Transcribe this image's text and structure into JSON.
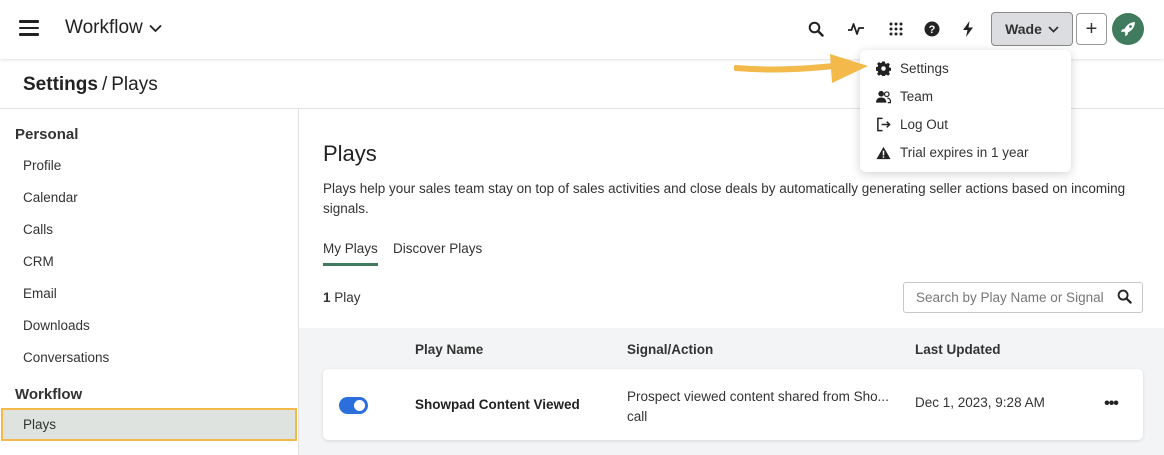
{
  "app": {
    "title": "Workflow"
  },
  "topbar": {
    "user_label": "Wade",
    "icons": [
      "search-icon",
      "activity-icon",
      "apps-grid-icon",
      "help-icon",
      "lightning-icon",
      "plus-icon",
      "rocket-icon"
    ],
    "plus_label": "+",
    "colors": {
      "accent": "#3f7b5c",
      "user_button_bg": "#dcdde0"
    }
  },
  "breadcrumb": {
    "section": "Settings",
    "separator": "/",
    "page": "Plays"
  },
  "sidebar": {
    "groups": [
      {
        "label": "Personal",
        "items": [
          "Profile",
          "Calendar",
          "Calls",
          "CRM",
          "Email",
          "Downloads",
          "Conversations"
        ]
      },
      {
        "label": "Workflow",
        "items": [
          "Plays"
        ]
      }
    ],
    "active_item": "Plays",
    "highlight_color": "#f3b94a"
  },
  "main": {
    "title": "Plays",
    "description": "Plays help your sales team stay on top of sales activities and close deals by automatically generating seller actions based on incoming signals.",
    "tabs": [
      {
        "label": "My Plays",
        "active": true
      },
      {
        "label": "Discover Plays",
        "active": false
      }
    ],
    "count_number": "1",
    "count_label": "Play",
    "search_placeholder": "Search by Play Name or Signal",
    "table": {
      "columns": [
        "Play Name",
        "Signal/Action",
        "Last Updated"
      ],
      "rows": [
        {
          "enabled": true,
          "name": "Showpad Content Viewed",
          "signal_line1": "Prospect viewed content shared from Sho...",
          "signal_line2": "call",
          "updated": "Dec 1, 2023, 9:28 AM",
          "more": "•••"
        }
      ]
    }
  },
  "user_menu": {
    "items": [
      {
        "label": "Settings",
        "icon": "gear-icon"
      },
      {
        "label": "Team",
        "icon": "team-icon"
      },
      {
        "label": "Log Out",
        "icon": "logout-icon"
      },
      {
        "label": "Trial expires in 1 year",
        "icon": "warning-icon"
      }
    ]
  },
  "annotation": {
    "arrow_color": "#f3b94a"
  }
}
